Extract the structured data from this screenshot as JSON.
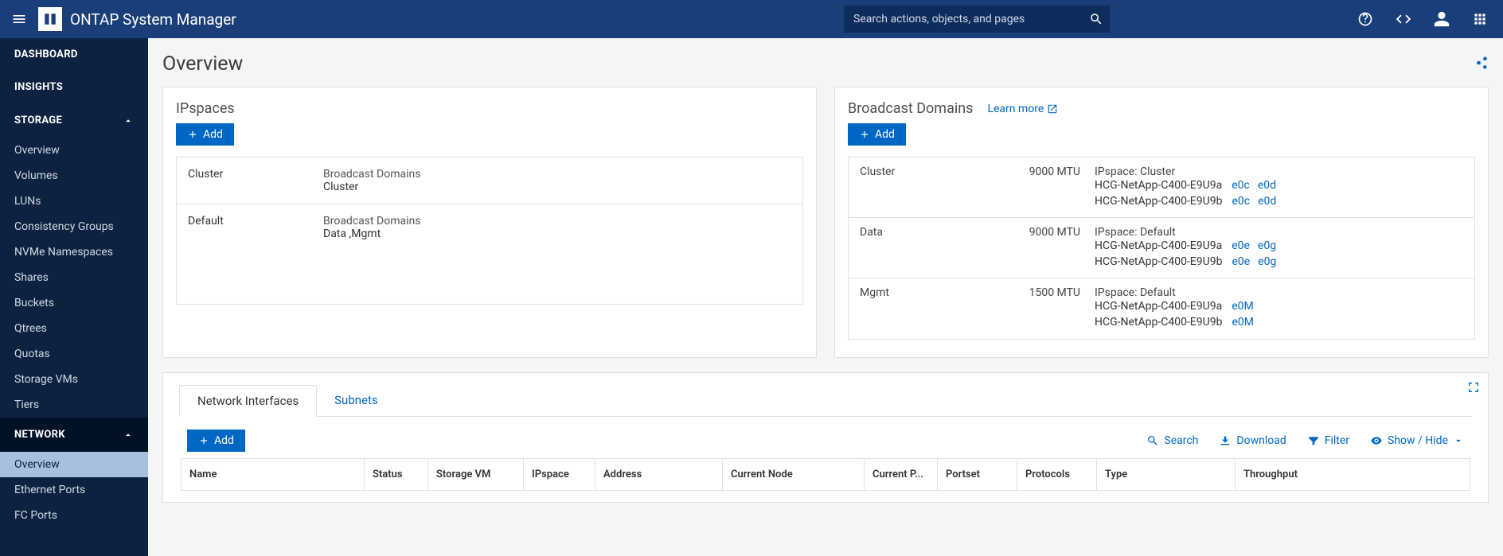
{
  "header": {
    "title": "ONTAP System Manager",
    "search_placeholder": "Search actions, objects, and pages"
  },
  "sidebar": {
    "dashboard": "DASHBOARD",
    "insights": "INSIGHTS",
    "storage": {
      "label": "STORAGE",
      "items": [
        "Overview",
        "Volumes",
        "LUNs",
        "Consistency Groups",
        "NVMe Namespaces",
        "Shares",
        "Buckets",
        "Qtrees",
        "Quotas",
        "Storage VMs",
        "Tiers"
      ]
    },
    "network": {
      "label": "NETWORK",
      "items": [
        "Overview",
        "Ethernet Ports",
        "FC Ports"
      ]
    }
  },
  "page": {
    "title": "Overview"
  },
  "ipspaces": {
    "title": "IPspaces",
    "add_label": "Add",
    "rows": [
      {
        "name": "Cluster",
        "sub_label": "Broadcast Domains",
        "sub_value": "Cluster"
      },
      {
        "name": "Default",
        "sub_label": "Broadcast Domains",
        "sub_value": "Data ,Mgmt"
      }
    ]
  },
  "broadcast": {
    "title": "Broadcast Domains",
    "learn_more": "Learn more",
    "add_label": "Add",
    "rows": [
      {
        "name": "Cluster",
        "mtu": "9000 MTU",
        "ipspace": "IPspace: Cluster",
        "nodes": [
          {
            "node": "HCG-NetApp-C400-E9U9a",
            "ports": [
              "e0c",
              "e0d"
            ]
          },
          {
            "node": "HCG-NetApp-C400-E9U9b",
            "ports": [
              "e0c",
              "e0d"
            ]
          }
        ]
      },
      {
        "name": "Data",
        "mtu": "9000 MTU",
        "ipspace": "IPspace: Default",
        "nodes": [
          {
            "node": "HCG-NetApp-C400-E9U9a",
            "ports": [
              "e0e",
              "e0g"
            ]
          },
          {
            "node": "HCG-NetApp-C400-E9U9b",
            "ports": [
              "e0e",
              "e0g"
            ]
          }
        ]
      },
      {
        "name": "Mgmt",
        "mtu": "1500 MTU",
        "ipspace": "IPspace: Default",
        "nodes": [
          {
            "node": "HCG-NetApp-C400-E9U9a",
            "ports": [
              "e0M"
            ]
          },
          {
            "node": "HCG-NetApp-C400-E9U9b",
            "ports": [
              "e0M"
            ]
          }
        ]
      }
    ]
  },
  "nif": {
    "tabs": [
      "Network Interfaces",
      "Subnets"
    ],
    "add_label": "Add",
    "search_label": "Search",
    "download_label": "Download",
    "filter_label": "Filter",
    "showhide_label": "Show / Hide",
    "columns": [
      "Name",
      "Status",
      "Storage VM",
      "IPspace",
      "Address",
      "Current Node",
      "Current P...",
      "Portset",
      "Protocols",
      "Type",
      "Throughput"
    ]
  }
}
